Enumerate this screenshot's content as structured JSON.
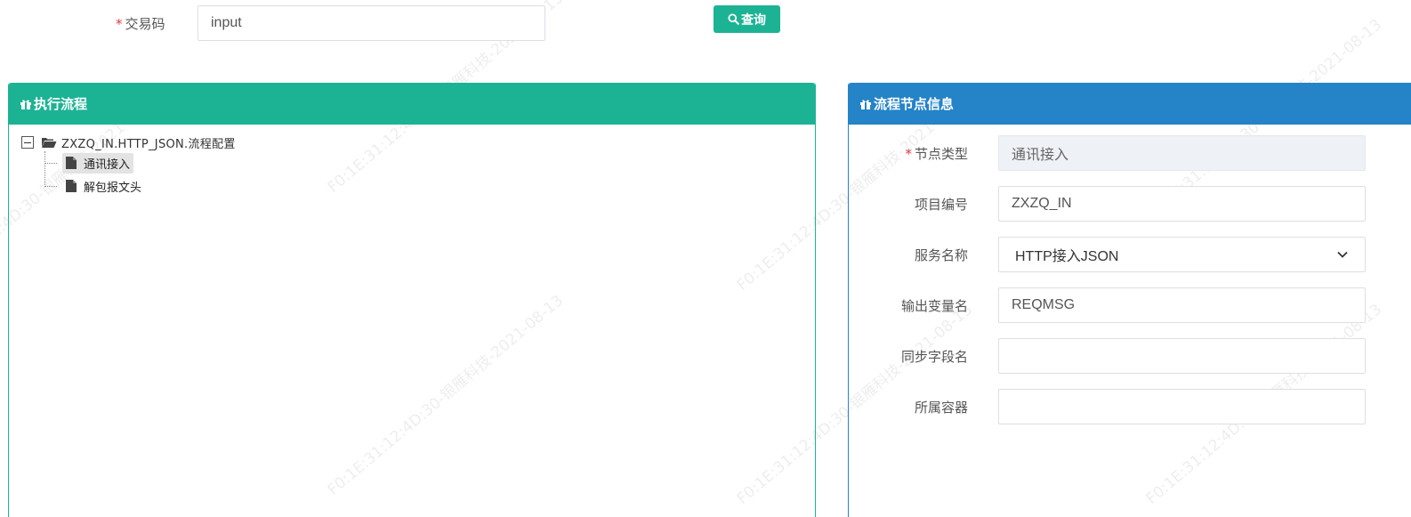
{
  "search": {
    "label": "交易码",
    "required_mark": "*",
    "value": "input",
    "query_button": "查询"
  },
  "left_panel": {
    "title": "执行流程",
    "tree": {
      "root_label": "ZXZQ_IN.HTTP_JSON.流程配置",
      "children": [
        {
          "label": "通讯接入"
        },
        {
          "label": "解包报文头"
        }
      ]
    }
  },
  "right_panel": {
    "title": "流程节点信息",
    "fields": {
      "node_type": {
        "label": "节点类型",
        "required_mark": "*",
        "value": "通讯接入"
      },
      "project_no": {
        "label": "项目编号",
        "value": "ZXZQ_IN"
      },
      "service_name": {
        "label": "服务名称",
        "value": "HTTP接入JSON"
      },
      "output_var": {
        "label": "输出变量名",
        "value": "REQMSG"
      },
      "sync_field": {
        "label": "同步字段名",
        "value": ""
      },
      "container": {
        "label": "所属容器",
        "value": ""
      }
    }
  },
  "watermark": "F0:1E:31:12:4D:30-银雁科技-2021-08-13",
  "colors": {
    "accent_green": "#1cb394",
    "accent_blue": "#2583c8",
    "required_red": "#e4393c"
  }
}
